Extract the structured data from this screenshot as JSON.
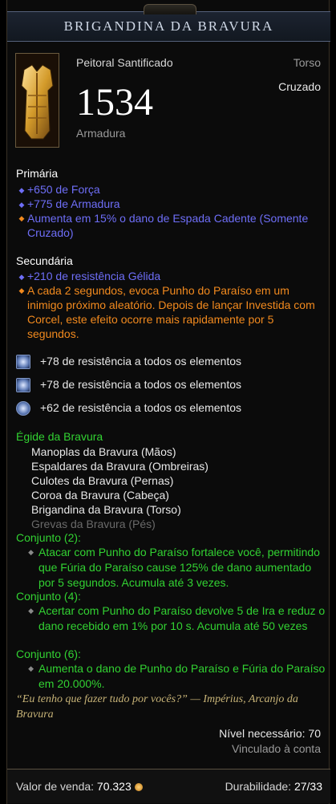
{
  "item": {
    "name": "BRIGANDINA DA BRAVURA",
    "type": "Peitoral Santificado",
    "slot": "Torso",
    "class": "Cruzado",
    "armor_value": "1534",
    "armor_label": "Armadura"
  },
  "primary": {
    "title": "Primária",
    "props": [
      {
        "text": "+650 de Força",
        "color": "blue"
      },
      {
        "text": "+775 de Armadura",
        "color": "blue"
      },
      {
        "text": "Aumenta em 15% o dano de Espada Cadente (Somente Cruzado)",
        "color": "blue"
      }
    ]
  },
  "secondary": {
    "title": "Secundária",
    "props": [
      {
        "text": "+210 de resistência Gélida",
        "color": "blue"
      },
      {
        "text": "A cada 2 segundos, evoca Punho do Paraíso em um inimigo próximo aleatório. Depois de lançar Investida com Corcel, este efeito ocorre mais rapidamente por 5 segundos.",
        "color": "orange"
      }
    ]
  },
  "sockets": [
    {
      "text": "+78 de resistência a todos os elementos",
      "icon": "diamond-gem-icon"
    },
    {
      "text": "+78 de resistência a todos os elementos",
      "icon": "diamond-gem-icon"
    },
    {
      "text": "+62 de resistência a todos os elementos",
      "icon": "round-gem-icon"
    }
  ],
  "set": {
    "name": "Égide da Bravura",
    "items": [
      {
        "text": "Manoplas da Bravura (Mãos)",
        "owned": true
      },
      {
        "text": "Espaldares da Bravura (Ombreiras)",
        "owned": true
      },
      {
        "text": "Culotes da Bravura (Pernas)",
        "owned": true
      },
      {
        "text": "Coroa da Bravura (Cabeça)",
        "owned": true
      },
      {
        "text": "Brigandina da Bravura (Torso)",
        "owned": true
      },
      {
        "text": "Grevas da Bravura (Pés)",
        "owned": false
      }
    ],
    "bonuses": [
      {
        "label": "Conjunto (2):",
        "text": "Atacar com Punho do Paraíso fortalece você, permitindo que Fúria do Paraíso cause 125% de dano aumentado por 5 segundos. Acumula até 3 vezes."
      },
      {
        "label": "Conjunto (4):",
        "text": "Acertar com Punho do Paraíso devolve 5 de Ira e reduz o dano recebido em 1% por 10 s. Acumula até 50 vezes"
      },
      {
        "label": "Conjunto (6):",
        "text": "Aumenta o dano de Punho do Paraíso e Fúria do Paraíso em 20.000%."
      }
    ]
  },
  "flavor": "“Eu tenho que fazer tudo por vocês?” — Impérius, Arcanjo da Bravura",
  "requirements": {
    "level": "Nível necessário: 70",
    "bound": "Vinculado à conta"
  },
  "footer": {
    "sell_label": "Valor de venda:",
    "sell_value": "70.323",
    "durability_label": "Durabilidade:",
    "durability_value": "27/33"
  },
  "colors": {
    "magic_blue": "#6e6ef7",
    "legendary_orange": "#f28a1e",
    "set_green": "#32d232",
    "flavor_gold": "#c7b377"
  }
}
